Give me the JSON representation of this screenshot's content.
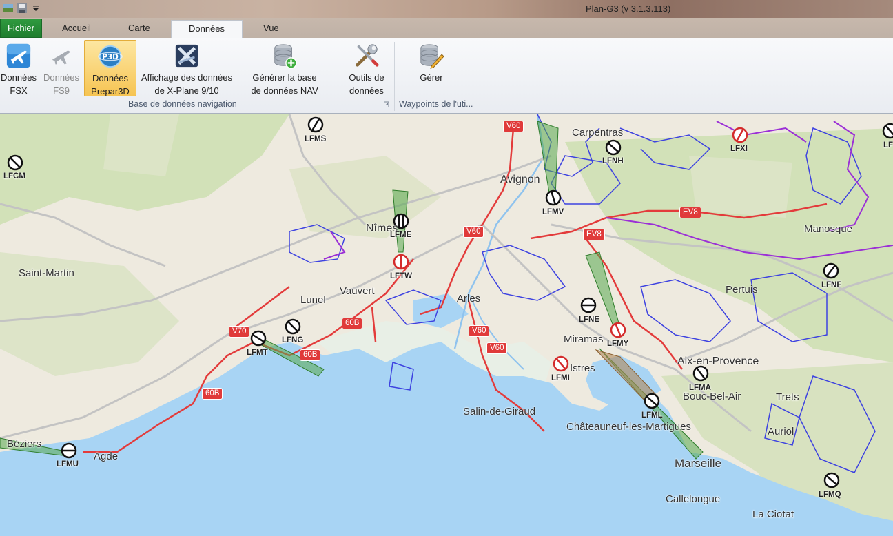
{
  "window": {
    "title": "Plan-G3 (v 3.1.3.113)"
  },
  "tabs": [
    {
      "label": "Fichier"
    },
    {
      "label": "Accueil"
    },
    {
      "label": "Carte"
    },
    {
      "label": "Données"
    },
    {
      "label": "Vue"
    }
  ],
  "ribbon": {
    "buttons": [
      {
        "label1": "Données",
        "label2": "FSX"
      },
      {
        "label1": "Données",
        "label2": "FS9"
      },
      {
        "label1": "Données",
        "label2": "Prepar3D"
      },
      {
        "label1": "Affichage des données",
        "label2": "de X-Plane 9/10"
      },
      {
        "label1": "Générer la base",
        "label2": "de données NAV"
      },
      {
        "label1": "Outils de",
        "label2": "données"
      },
      {
        "label1": "Gérer",
        "label2": ""
      }
    ],
    "groups": [
      {
        "label": "Base de données navigation"
      },
      {
        "label": "Waypoints de l'uti..."
      }
    ]
  },
  "map": {
    "places": [
      "Carpentras",
      "Avignon",
      "Nîmes",
      "Saint-Martin",
      "Lunel",
      "Vauvert",
      "Arles",
      "Manosque",
      "Pertuis",
      "Miramas",
      "Istres",
      "Aix-en-Provence",
      "Bouc-Bel-Air",
      "Trets",
      "Salin-de-Giraud",
      "Châteauneuf-les-Martigues",
      "Auriol",
      "Béziers",
      "Agde",
      "Marseille",
      "Callelongue",
      "La Ciotat"
    ],
    "airports": [
      "LFMS",
      "LFCM",
      "LFXI",
      "LFNH",
      "LFMV",
      "LFME",
      "LFTW",
      "LFNF",
      "LFNE",
      "LFMY",
      "LFNG",
      "LFMT",
      "LFMI",
      "LFMA",
      "LFML",
      "LFMU",
      "LFMQ",
      "LF"
    ],
    "road_shields": [
      "V60",
      "V60",
      "EV8",
      "EV8",
      "V70",
      "60B",
      "60B",
      "V60",
      "V60",
      "60B"
    ]
  }
}
